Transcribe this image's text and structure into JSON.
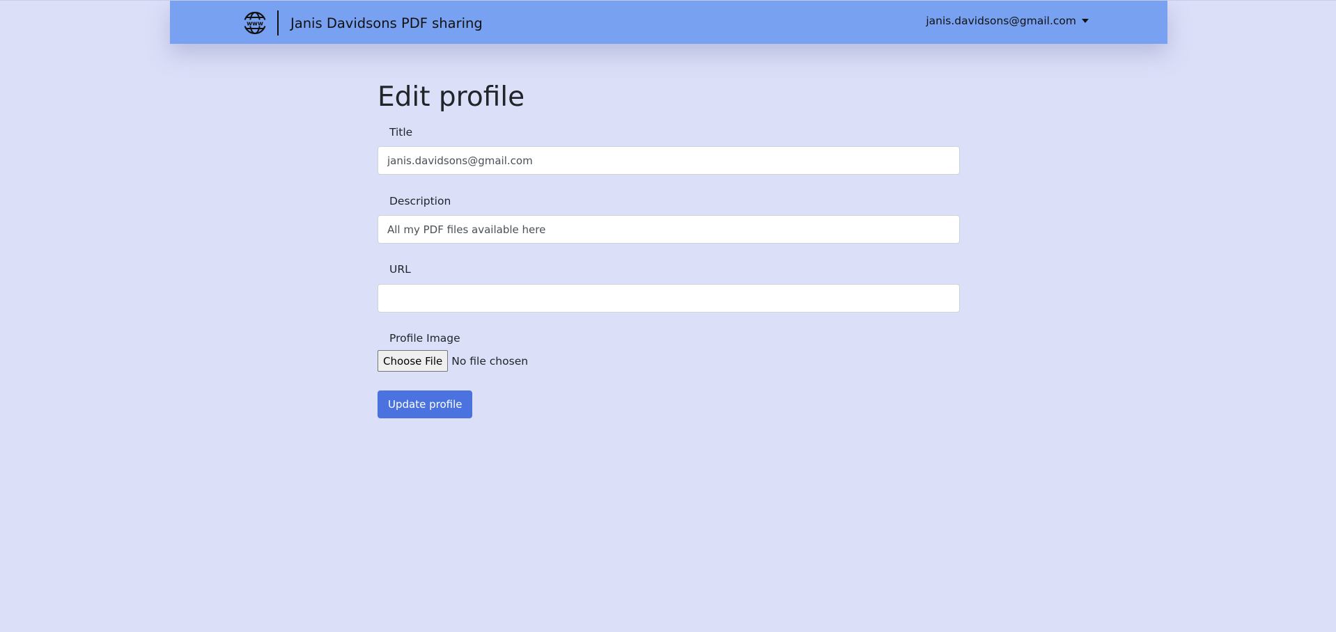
{
  "navbar": {
    "brand_title": "Janis Davidsons PDF sharing",
    "logo_icon": "globe-www-icon",
    "user_email": "janis.davidsons@gmail.com",
    "user_menu_icon": "caret-down-icon",
    "color": "#78a2f1"
  },
  "page": {
    "title": "Edit profile",
    "background_color": "#dbdff8"
  },
  "form": {
    "title_label": "Title",
    "title_value": "janis.davidsons@gmail.com",
    "description_label": "Description",
    "description_value": "All my PDF files available here",
    "url_label": "URL",
    "url_value": "",
    "profile_image_label": "Profile Image",
    "choose_file_label": "Choose File",
    "file_status": "No file chosen",
    "submit_label": "Update profile",
    "submit_color": "#4a73e0"
  }
}
